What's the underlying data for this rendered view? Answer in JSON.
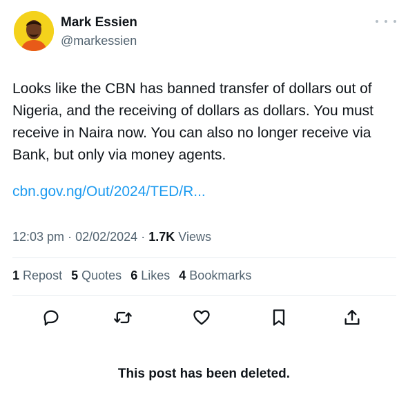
{
  "author": {
    "display_name": "Mark Essien",
    "handle": "@markessien",
    "avatar_bg": "#f4d21c"
  },
  "post": {
    "text": "Looks like the CBN has banned transfer of dollars out of Nigeria, and the receiving of dollars as dollars. You must receive in Naira now. You can also no longer receive via Bank, but only via money agents.",
    "link": "cbn.gov.ng/Out/2024/TED/R..."
  },
  "meta": {
    "time": "12:03 pm",
    "sep1": "·",
    "date": "02/02/2024",
    "sep2": "·",
    "views_count": "1.7K",
    "views_label": "Views"
  },
  "stats": {
    "reposts_count": "1",
    "reposts_label": "Repost",
    "quotes_count": "5",
    "quotes_label": "Quotes",
    "likes_count": "6",
    "likes_label": "Likes",
    "bookmarks_count": "4",
    "bookmarks_label": "Bookmarks"
  },
  "actions": [
    "reply-icon",
    "repost-icon",
    "like-icon",
    "bookmark-icon",
    "share-icon"
  ],
  "notice": "This post has been deleted.",
  "colors": {
    "link": "#1d9bf0",
    "secondary_text": "#536471",
    "primary_text": "#0f1419"
  }
}
